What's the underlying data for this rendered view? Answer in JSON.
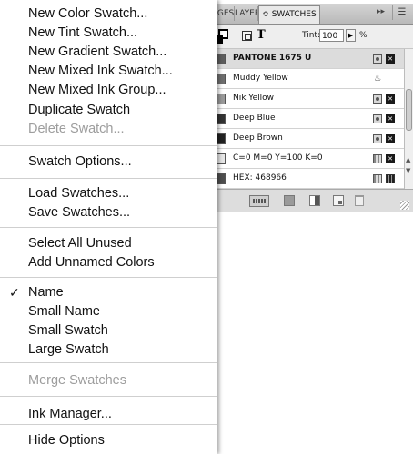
{
  "panel": {
    "tabs": [
      {
        "label": "PAGES"
      },
      {
        "label": "LAYERS"
      },
      {
        "label": "≎ SWATCHES"
      }
    ],
    "collapse_glyph": "▸▸",
    "menu_glyph": "☰",
    "tint_label": "Tint:",
    "tint_value": "100",
    "tint_unit": "%",
    "stepper_glyph": "▶",
    "swatches": [
      {
        "name": "PANTONE 1675 U",
        "color": "#5e5e5e",
        "selected": true,
        "icon1": "spot-icon",
        "icon2": "no-edit-icon"
      },
      {
        "name": "Muddy Yellow",
        "color": "#6f6f6f",
        "selected": false,
        "icon1": "mixed-ink-icon",
        "icon2": ""
      },
      {
        "name": "Nik Yellow",
        "color": "#9a9a9a",
        "selected": false,
        "icon1": "spot-icon",
        "icon2": "no-edit-icon"
      },
      {
        "name": "Deep Blue",
        "color": "#333333",
        "selected": false,
        "icon1": "spot-icon",
        "icon2": "no-edit-icon"
      },
      {
        "name": "Deep Brown",
        "color": "#222222",
        "selected": false,
        "icon1": "spot-icon",
        "icon2": "no-edit-icon"
      },
      {
        "name": "C=0 M=0 Y=100 K=0",
        "color": "#e6e6e6",
        "selected": false,
        "icon1": "process-icon",
        "icon2": "no-edit-icon"
      },
      {
        "name": "HEX: 468966",
        "color": "#4e4e4e",
        "selected": false,
        "icon1": "process-icon",
        "icon2": "cmyk-icon"
      }
    ]
  },
  "menu": {
    "items": [
      {
        "label": "New Color Swatch...",
        "disabled": false,
        "checked": false
      },
      {
        "label": "New Tint Swatch...",
        "disabled": false,
        "checked": false
      },
      {
        "label": "New Gradient Swatch...",
        "disabled": false,
        "checked": false
      },
      {
        "label": "New Mixed Ink Swatch...",
        "disabled": false,
        "checked": false
      },
      {
        "label": "New Mixed Ink Group...",
        "disabled": false,
        "checked": false
      },
      {
        "label": "Duplicate Swatch",
        "disabled": false,
        "checked": false
      },
      {
        "label": "Delete Swatch...",
        "disabled": true,
        "checked": false
      },
      {
        "label": "Swatch Options...",
        "disabled": false,
        "checked": false
      },
      {
        "label": "Load Swatches...",
        "disabled": false,
        "checked": false
      },
      {
        "label": "Save Swatches...",
        "disabled": false,
        "checked": false
      },
      {
        "label": "Select All Unused",
        "disabled": false,
        "checked": false
      },
      {
        "label": "Add Unnamed Colors",
        "disabled": false,
        "checked": false
      },
      {
        "label": "Name",
        "disabled": false,
        "checked": true
      },
      {
        "label": "Small Name",
        "disabled": false,
        "checked": false
      },
      {
        "label": "Small Swatch",
        "disabled": false,
        "checked": false
      },
      {
        "label": "Large Swatch",
        "disabled": false,
        "checked": false
      },
      {
        "label": "Merge Swatches",
        "disabled": true,
        "checked": false
      },
      {
        "label": "Ink Manager...",
        "disabled": false,
        "checked": false
      },
      {
        "label": "Hide Options",
        "disabled": false,
        "checked": false
      }
    ],
    "check_glyph": "✓"
  }
}
